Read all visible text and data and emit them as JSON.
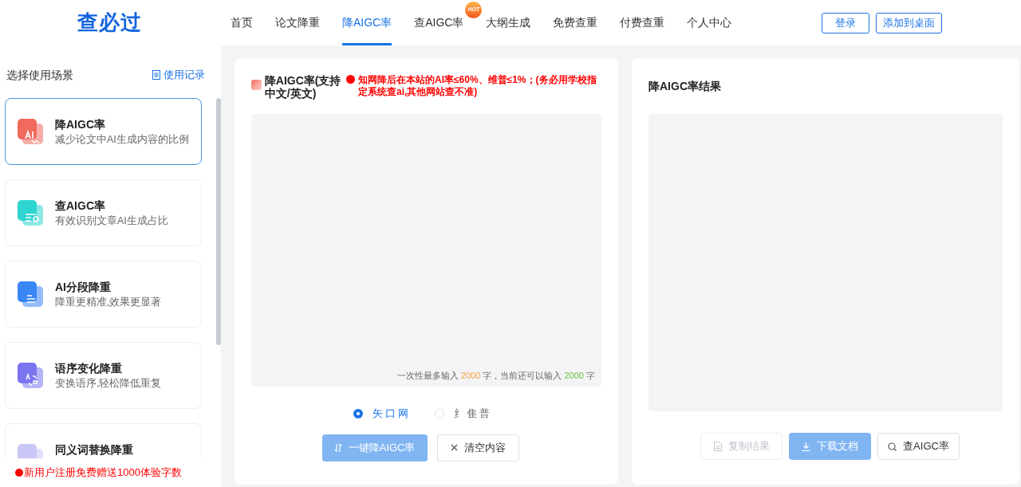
{
  "header": {
    "logo": "查必过",
    "nav": [
      {
        "label": "首页",
        "selected": false
      },
      {
        "label": "论文降重",
        "selected": false
      },
      {
        "label": "降AIGC率",
        "selected": true
      },
      {
        "label": "查AIGC率",
        "selected": false,
        "badge": "HOT"
      },
      {
        "label": "大纲生成",
        "selected": false
      },
      {
        "label": "免费查重",
        "selected": false
      },
      {
        "label": "付费查重",
        "selected": false
      },
      {
        "label": "个人中心",
        "selected": false
      }
    ],
    "buttons": [
      "登录",
      "添加到桌面"
    ]
  },
  "sidebar": {
    "title": "选择使用场景",
    "history_link": "使用记录",
    "items": [
      {
        "title": "降AIGC率",
        "desc": "减少论文中AI生成内容的比例",
        "selected": true,
        "kind": "ai",
        "color": "#f06a5e"
      },
      {
        "title": "查AIGC率",
        "desc": "有效识别文章AI生成占比",
        "selected": false,
        "kind": "search",
        "color": "#2fd6d0"
      },
      {
        "title": "AI分段降重",
        "desc": "降重更精准,效果更显著",
        "selected": false,
        "kind": "doc",
        "color": "#3a86f5"
      },
      {
        "title": "语序变化降重",
        "desc": "变换语序,轻松降低重复",
        "selected": false,
        "kind": "swap",
        "color": "#7b74f0"
      },
      {
        "title": "同义词替换降重",
        "selected": false,
        "kind": "none",
        "color": "#c9c7f5"
      }
    ],
    "notice": "新用户注册免费赠送1000体验字数"
  },
  "input_panel": {
    "title": "降AIGC率(支持中文/英文)",
    "warning": "知网降后在本站的AI率≤60%、维普≤1%；(务必用学校指定系统查ai,其他网站查不准)",
    "hint_prefix": "一次性最多输入",
    "max": "2000",
    "hint_middle": "字，当前还可以输入",
    "remaining": "2000",
    "hint_suffix": "字",
    "radios": [
      {
        "label": "矢口网",
        "selected": true
      },
      {
        "label": "纟隹普",
        "selected": false
      }
    ],
    "buttons": [
      {
        "label": "一键降AIGC率",
        "kind": "primary"
      },
      {
        "label": "清空内容",
        "kind": "clear"
      }
    ]
  },
  "result_panel": {
    "title": "降AIGC率结果",
    "buttons": [
      {
        "label": "复制结果",
        "kind": "copy",
        "disabled": true
      },
      {
        "label": "下载文档",
        "kind": "download",
        "disabled": false
      },
      {
        "label": "查AIGC率",
        "kind": "check",
        "disabled": false
      }
    ]
  }
}
